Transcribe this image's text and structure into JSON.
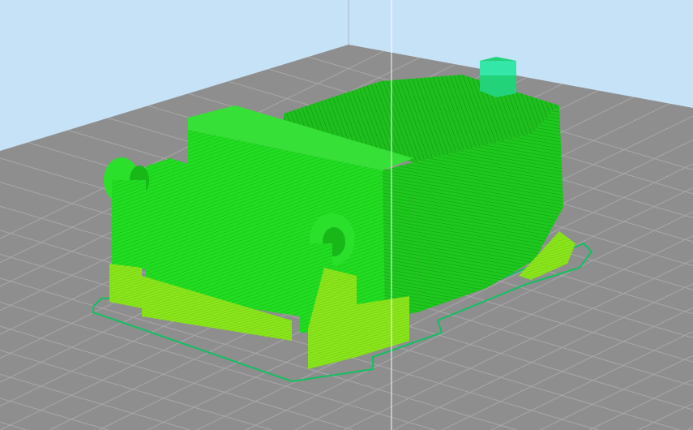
{
  "viewport": {
    "type": "3d-print-preview",
    "colors": {
      "sky": "#c6e2f6",
      "plate": "#8e8e8e",
      "grid_line": "#a9a9a9",
      "wall": "#22dd22",
      "wall_dark": "#11b311",
      "infill": "#1fc41f",
      "support": "#88e61a",
      "skirt": "#12c060",
      "top_layer": "#2ee0a0",
      "axis_line": "#ffffff"
    }
  }
}
